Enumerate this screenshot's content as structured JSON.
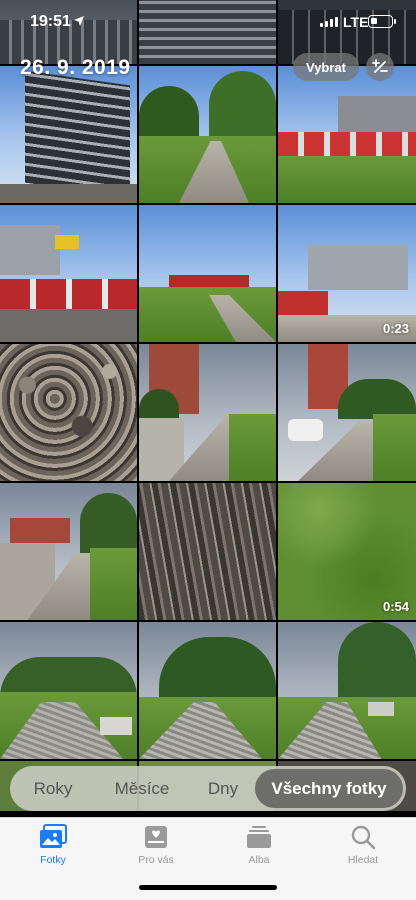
{
  "status_bar": {
    "time": "19:51",
    "network": "LTE",
    "signal_bars": 4
  },
  "header": {
    "date": "26. 9. 2019",
    "select_label": "Vybrat",
    "zoom_label": "+/-"
  },
  "photos": [
    {
      "kind": "building-top"
    },
    {
      "kind": "building-facade"
    },
    {
      "kind": "dark-facade"
    },
    {
      "kind": "office-building"
    },
    {
      "kind": "grass-path"
    },
    {
      "kind": "bus-station"
    },
    {
      "kind": "street-bus"
    },
    {
      "kind": "park-bus"
    },
    {
      "kind": "bus-parking",
      "duration": "0:23"
    },
    {
      "kind": "pebbles"
    },
    {
      "kind": "walkway-wall"
    },
    {
      "kind": "walkway-car"
    },
    {
      "kind": "cloudy-walkway"
    },
    {
      "kind": "tree-bark"
    },
    {
      "kind": "grass-closeup",
      "duration": "0:54"
    },
    {
      "kind": "alley-trees"
    },
    {
      "kind": "cobble-alley"
    },
    {
      "kind": "bench-path"
    }
  ],
  "segments": [
    "Roky",
    "Měsíce",
    "Dny",
    "Všechny fotky"
  ],
  "active_segment": "Všechny fotky",
  "tabs": [
    {
      "label": "Fotky",
      "icon": "photos-icon",
      "active": true
    },
    {
      "label": "Pro vás",
      "icon": "for-you-icon",
      "active": false
    },
    {
      "label": "Alba",
      "icon": "albums-icon",
      "active": false
    },
    {
      "label": "Hledat",
      "icon": "search-icon",
      "active": false
    }
  ],
  "colors": {
    "accent": "#1b7cf5",
    "tab_inactive": "#999999"
  }
}
